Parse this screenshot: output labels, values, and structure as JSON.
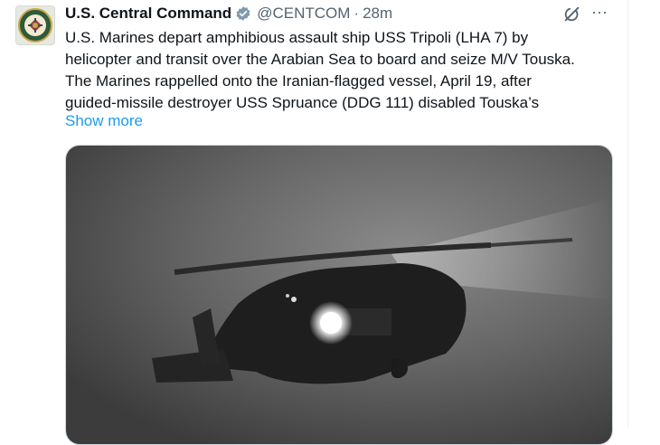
{
  "tweet": {
    "author_name": "U.S. Central Command",
    "handle": "@CENTCOM",
    "separator": "·",
    "time": "28m",
    "text_lines": [
      "U.S. Marines depart amphibious assault ship USS Tripoli (LHA 7) by",
      "helicopter and transit over the Arabian Sea to board and seize M/V Touska.",
      "The Marines rappelled onto the Iranian-flagged vessel, April 19, after",
      "guided-missile destroyer USS Spruance (DDG 111) disabled Touska’s"
    ],
    "show_more": "Show more",
    "more_menu": "···",
    "icons": {
      "avatar": "centcom-seal-icon",
      "verified": "verified-badge-icon",
      "grok": "grok-icon",
      "more": "more-options-icon"
    },
    "colors": {
      "link": "#1d9bf0",
      "secondary_text": "#536471",
      "verified_badge": "#829aab"
    },
    "media": {
      "description_icon": "photo-helicopter-night"
    }
  }
}
